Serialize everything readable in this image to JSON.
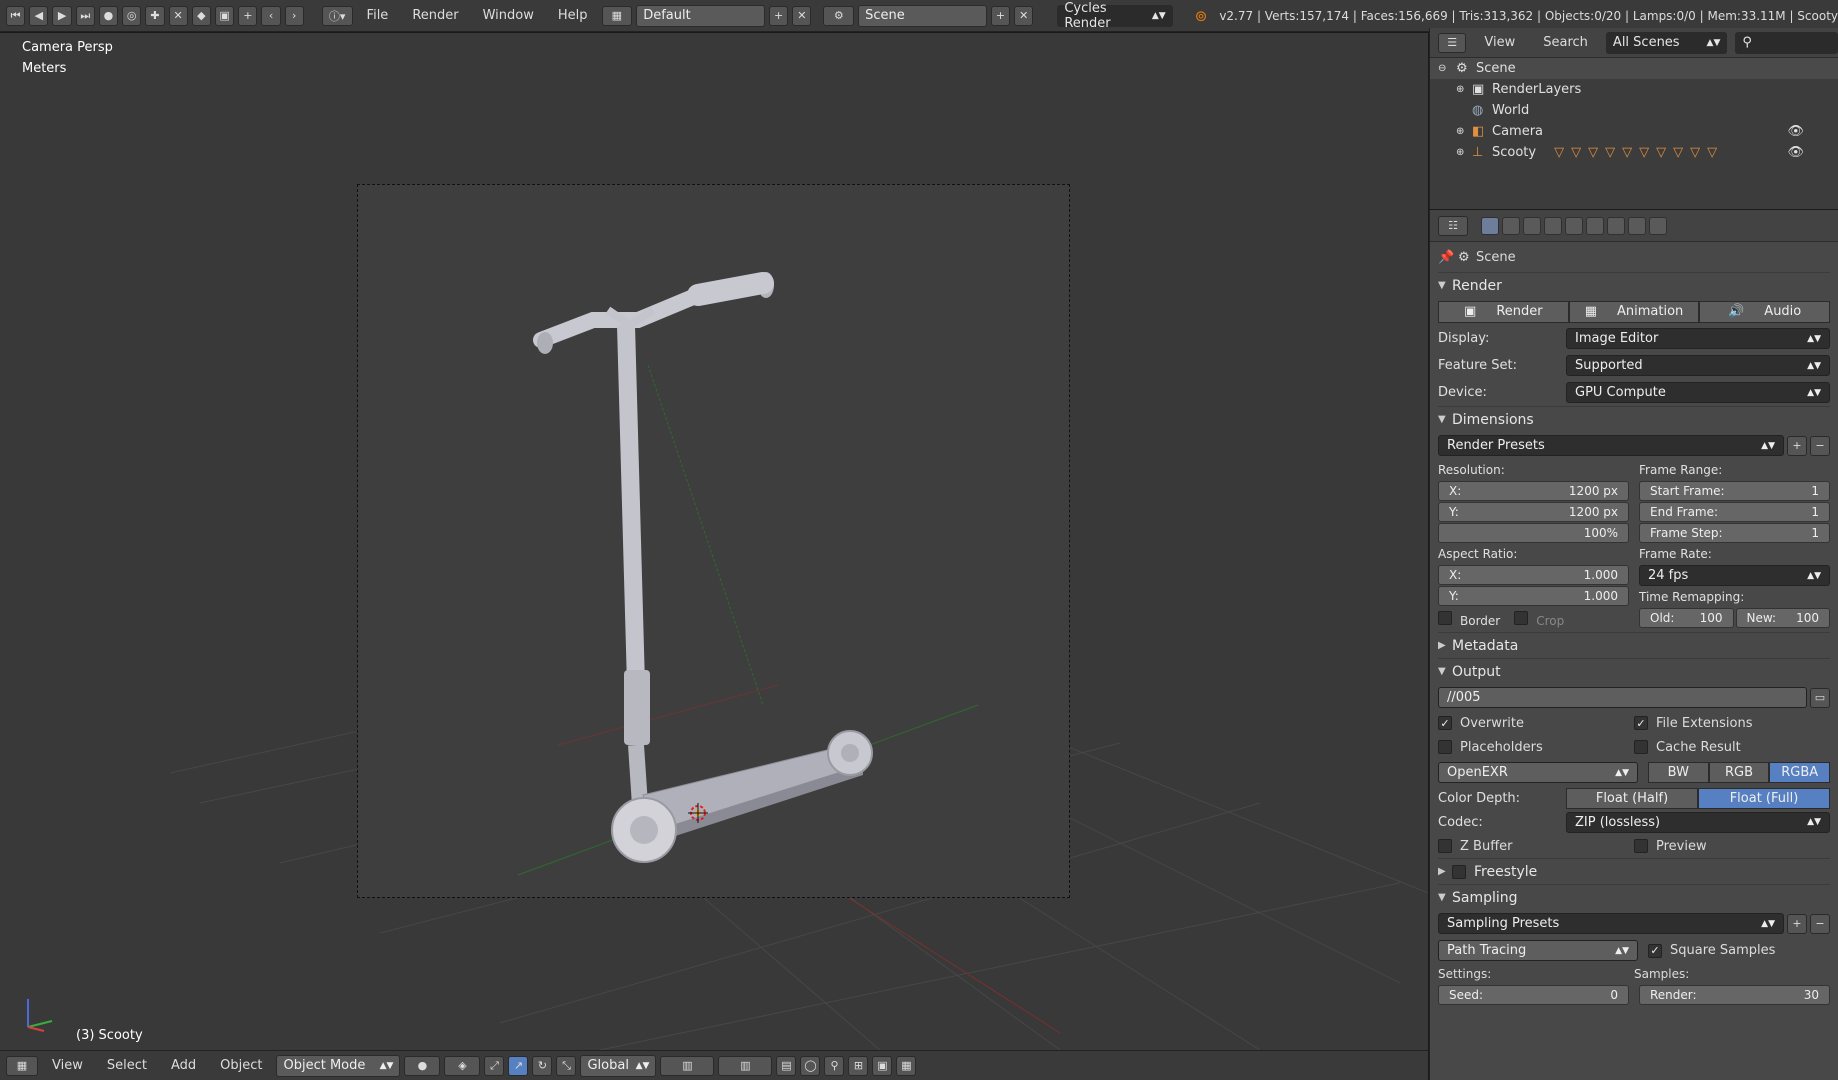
{
  "topbar": {
    "menus": [
      "File",
      "Render",
      "Window",
      "Help"
    ],
    "layout_name": "Default",
    "scene_name": "Scene",
    "render_engine": "Cycles Render",
    "stats": "v2.77 | Verts:157,174 | Faces:156,669 | Tris:313,362 | Objects:0/20 | Lamps:0/0 | Mem:33.11M | Scooty"
  },
  "viewport": {
    "view_name": "Camera Persp",
    "units": "Meters",
    "object_label": "(3) Scooty"
  },
  "bottombar": {
    "menus": [
      "View",
      "Select",
      "Add",
      "Object"
    ],
    "mode": "Object Mode",
    "orientation": "Global"
  },
  "outliner": {
    "menus": [
      "View",
      "Search"
    ],
    "filter": "All Scenes",
    "items": [
      "Scene",
      "RenderLayers",
      "World",
      "Camera",
      "Scooty"
    ]
  },
  "properties": {
    "context": "Scene",
    "render": {
      "title": "Render",
      "buttons": [
        "Render",
        "Animation",
        "Audio"
      ],
      "display_label": "Display:",
      "display_value": "Image Editor",
      "feature_label": "Feature Set:",
      "feature_value": "Supported",
      "device_label": "Device:",
      "device_value": "GPU Compute"
    },
    "dimensions": {
      "title": "Dimensions",
      "presets": "Render Presets",
      "resolution_label": "Resolution:",
      "res_x": "1200 px",
      "res_y": "1200 px",
      "res_pct": "100%",
      "frame_range_label": "Frame Range:",
      "start_label": "Start Frame:",
      "start": "1",
      "end_label": "End Frame:",
      "end": "1",
      "step_label": "Frame Step:",
      "step": "1",
      "aspect_label": "Aspect Ratio:",
      "aspect_x": "1.000",
      "aspect_y": "1.000",
      "frame_rate_label": "Frame Rate:",
      "frame_rate": "24 fps",
      "remap_label": "Time Remapping:",
      "old_label": "Old:",
      "old": "100",
      "new_label": "New:",
      "new": "100",
      "border_label": "Border",
      "crop_label": "Crop",
      "x_label": "X:",
      "y_label": "Y:"
    },
    "metadata_title": "Metadata",
    "output": {
      "title": "Output",
      "path": "//005",
      "overwrite": "Overwrite",
      "file_ext": "File Extensions",
      "placeholders": "Placeholders",
      "cache": "Cache Result",
      "format": "OpenEXR",
      "color_modes": [
        "BW",
        "RGB",
        "RGBA"
      ],
      "depth_label": "Color Depth:",
      "depths": [
        "Float (Half)",
        "Float (Full)"
      ],
      "codec_label": "Codec:",
      "codec": "ZIP (lossless)",
      "zbuffer": "Z Buffer",
      "preview": "Preview"
    },
    "freestyle_title": "Freestyle",
    "sampling": {
      "title": "Sampling",
      "presets": "Sampling Presets",
      "integrator": "Path Tracing",
      "square": "Square Samples",
      "settings_label": "Settings:",
      "samples_label": "Samples:",
      "seed_label": "Seed:",
      "seed": "0",
      "render_label": "Render:",
      "render_samples": "30"
    }
  },
  "colors": {
    "accent": "#5680c2",
    "viewport_bg": "#393939"
  }
}
